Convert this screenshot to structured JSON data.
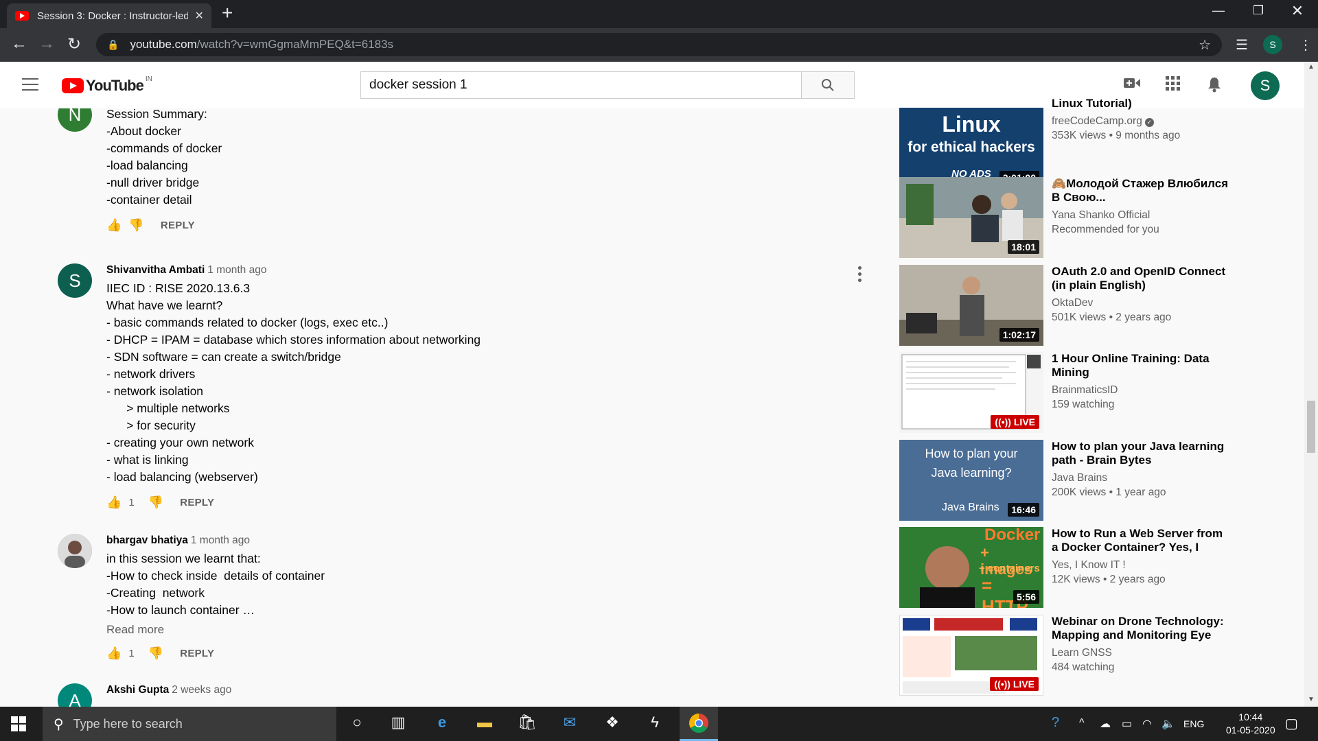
{
  "browser": {
    "tab_title": "Session 3: Docker : Instructor-led",
    "url_host": "youtube.com",
    "url_path": "/watch?v=wmGgmaMmPEQ&t=6183s",
    "profile_initial": "S"
  },
  "masthead": {
    "logo_text": "YouTube",
    "country": "IN",
    "search_value": "docker session 1",
    "avatar_initial": "S"
  },
  "comments": [
    {
      "avatar": "N",
      "avatar_color": "#2f7d32",
      "lines": [
        "Session Summary:",
        "-About docker",
        "-commands of docker",
        "-load balancing",
        "-null driver bridge",
        "-container detail"
      ],
      "likes": "",
      "reply": "REPLY"
    },
    {
      "avatar": "S",
      "avatar_color": "#0d5f4f",
      "author": "Shivanvitha Ambati",
      "time": "1 month ago",
      "lines": [
        "IIEC ID : RISE 2020.13.6.3",
        "What have we learnt?",
        "- basic commands related to docker (logs, exec etc..)",
        "- DHCP = IPAM = database which stores information about networking",
        "- SDN software = can create a switch/bridge",
        "- network drivers",
        "- network isolation",
        "      > multiple networks",
        "      > for security",
        "- creating your own network",
        "- what is linking",
        "- load balancing (webserver)"
      ],
      "likes": "1",
      "reply": "REPLY"
    },
    {
      "avatar": "",
      "avatar_color": "#8d8d8d",
      "author": "bhargav bhatiya",
      "time": "1 month ago",
      "lines": [
        "in this session we learnt that:",
        "-How to check inside  details of container",
        "-Creating  network",
        "-How to launch container …"
      ],
      "read_more": "Read more",
      "likes": "1",
      "reply": "REPLY"
    },
    {
      "avatar": "A",
      "avatar_color": "#00897b",
      "author": "Akshi Gupta",
      "time": "2 weeks ago"
    }
  ],
  "recommendations": [
    {
      "title": "Linux Tutorial)",
      "channel": "freeCodeCamp.org",
      "meta": "353K views • 9 months ago",
      "duration": "2:01:00",
      "thumb_text": [
        "Linux",
        "for ethical hackers",
        "NO ADS"
      ],
      "thumb_color": "#14406e"
    },
    {
      "title": "Молодой Стажер Влюбился В Свою...",
      "channel": "Yana Shanko Official",
      "meta": "Recommended for you",
      "duration": "18:01",
      "thumb_color": "#5a6a6e"
    },
    {
      "title": "OAuth 2.0 and OpenID Connect (in plain English)",
      "channel": "OktaDev",
      "meta": "501K views • 2 years ago",
      "duration": "1:02:17",
      "thumb_color": "#6b6558"
    },
    {
      "title": "1 Hour Online Training: Data Mining",
      "channel": "BrainmaticsID",
      "meta": "159 watching",
      "live": "LIVE",
      "thumb_color": "#e9ecef"
    },
    {
      "title": "How to plan your Java learning path - Brain Bytes",
      "channel": "Java Brains",
      "meta": "200K views • 1 year ago",
      "duration": "16:46",
      "thumb_text": [
        "How to plan your",
        "Java learning?",
        "Java Brains"
      ],
      "thumb_color": "#4a6d96"
    },
    {
      "title": "How to Run a Web Server from a Docker Container? Yes, I Kno...",
      "channel": "Yes, I Know IT !",
      "meta": "12K views • 2 years ago",
      "duration": "5:56",
      "thumb_text": [
        "Docker",
        "+ images",
        "+ containers",
        "= HTTP"
      ],
      "thumb_color": "#2e7d32"
    },
    {
      "title": "Webinar on Drone Technology: Mapping and Monitoring Eye",
      "channel": "Learn GNSS",
      "meta": "484 watching",
      "live": "LIVE",
      "thumb_color": "#ffffff"
    }
  ],
  "taskbar": {
    "search_placeholder": "Type here to search",
    "lang": "ENG",
    "time": "10:44",
    "date": "01-05-2020"
  }
}
